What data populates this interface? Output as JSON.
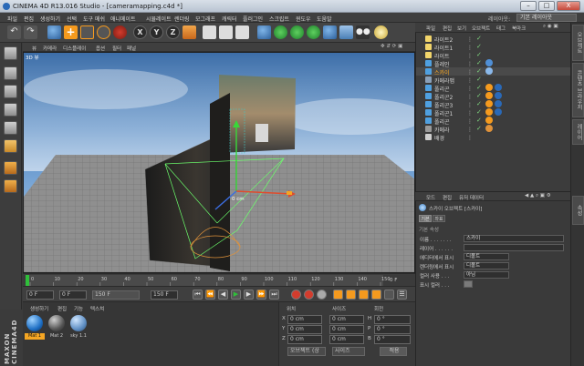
{
  "window": {
    "title": "CINEMA 4D R13.016 Studio - [cameramapping.c4d *]",
    "controls": [
      "–",
      "□",
      "X"
    ]
  },
  "menu": {
    "items": [
      "파일",
      "편집",
      "생성하기",
      "선택",
      "도구",
      "메쉬",
      "애니메이트",
      "시뮬레이트",
      "렌더링",
      "모그래프",
      "캐릭터",
      "플러그인",
      "스크립트",
      "윈도우",
      "도움말"
    ],
    "layout_label": "레이아웃:",
    "layout_value": "기본 레이아웃"
  },
  "toolbar": {
    "axis_labels": [
      "X",
      "Y",
      "Z"
    ]
  },
  "viewport": {
    "menu": [
      "뷰",
      "카메라",
      "디스플레이",
      "옵션",
      "필터",
      "패널"
    ],
    "label": "3D 뷰",
    "axis_readout": "0 cm"
  },
  "timeline": {
    "ticks": [
      "0",
      "10",
      "20",
      "30",
      "40",
      "50",
      "60",
      "70",
      "80",
      "90",
      "100",
      "110",
      "120",
      "130",
      "140",
      "150"
    ],
    "end_frame_label": "0 F",
    "current_frame": "0 F",
    "start_field": "0 F",
    "end_field": "150 F",
    "preview_end": "150 F",
    "playhead_fraction": 0.0
  },
  "materials": {
    "menu": [
      "생성하기",
      "편집",
      "기능",
      "텍스쳐"
    ],
    "items": [
      {
        "label": "Mat 1"
      },
      {
        "label": "Mat 2"
      },
      {
        "label": "sky 1.1"
      }
    ]
  },
  "coordinates": {
    "headers": [
      "위치",
      "사이즈",
      "회전"
    ],
    "rows": [
      {
        "axis": "X",
        "pos": "0 cm",
        "size": "0 cm",
        "rot_axis": "H",
        "rot": "0 °"
      },
      {
        "axis": "Y",
        "pos": "0 cm",
        "size": "0 cm",
        "rot_axis": "P",
        "rot": "0 °"
      },
      {
        "axis": "Z",
        "pos": "0 cm",
        "size": "0 cm",
        "rot_axis": "B",
        "rot": "0 °"
      }
    ],
    "mode_select": "오브젝트 (상",
    "size_select": "사이즈",
    "apply_button": "적용"
  },
  "objects": {
    "tabs": [
      "파일",
      "편집",
      "보기",
      "오브젝트",
      "태그",
      "북마크"
    ],
    "rows": [
      {
        "name": "라이트2",
        "color": "#f2d56b"
      },
      {
        "name": "라이트1",
        "color": "#f2d56b"
      },
      {
        "name": "라이트",
        "color": "#f2d56b"
      },
      {
        "name": "플레인",
        "color": "#4fa0e0"
      },
      {
        "name": "스카이",
        "color": "#4fa0e0"
      },
      {
        "name": "카메라맵",
        "color": "#8aa0b8"
      },
      {
        "name": "폴리곤",
        "color": "#4fa0e0"
      },
      {
        "name": "폴리곤2",
        "color": "#4fa0e0"
      },
      {
        "name": "폴리곤3",
        "color": "#4fa0e0"
      },
      {
        "name": "폴리곤1",
        "color": "#4fa0e0"
      },
      {
        "name": "폴리곤",
        "color": "#4fa0e0"
      },
      {
        "name": "카메라",
        "color": "#9a9a9a"
      },
      {
        "name": "배경",
        "color": "#cfcfcf"
      }
    ],
    "selected_index": 4
  },
  "attributes": {
    "tabs": [
      "모드",
      "편집",
      "유저 데이터"
    ],
    "object_header": "스카이 오브젝트 [스카이]",
    "subtabs": [
      "기본",
      "좌표"
    ],
    "section": "기본 속성",
    "fields": [
      {
        "label": "이름 . . . . . . .",
        "value": "스카이"
      },
      {
        "label": "레이어 . . . . . .",
        "value": ""
      },
      {
        "label": "에디터에서 표시",
        "value": "디폴트"
      },
      {
        "label": "렌더링에서 표시",
        "value": "디폴트"
      },
      {
        "label": "컬러 사용 . . .",
        "value": "아님"
      },
      {
        "label": "표시 컬러 . . .",
        "value": ""
      }
    ]
  },
  "side_tabs": [
    "오브젝트",
    "콘텐츠 브라우저",
    "레이어",
    "속성"
  ],
  "colors": {
    "accent_orange": "#f59a1e",
    "selection_orange": "#f5a623",
    "play_green": "#2fbf3a",
    "record_red": "#d33c2d"
  }
}
